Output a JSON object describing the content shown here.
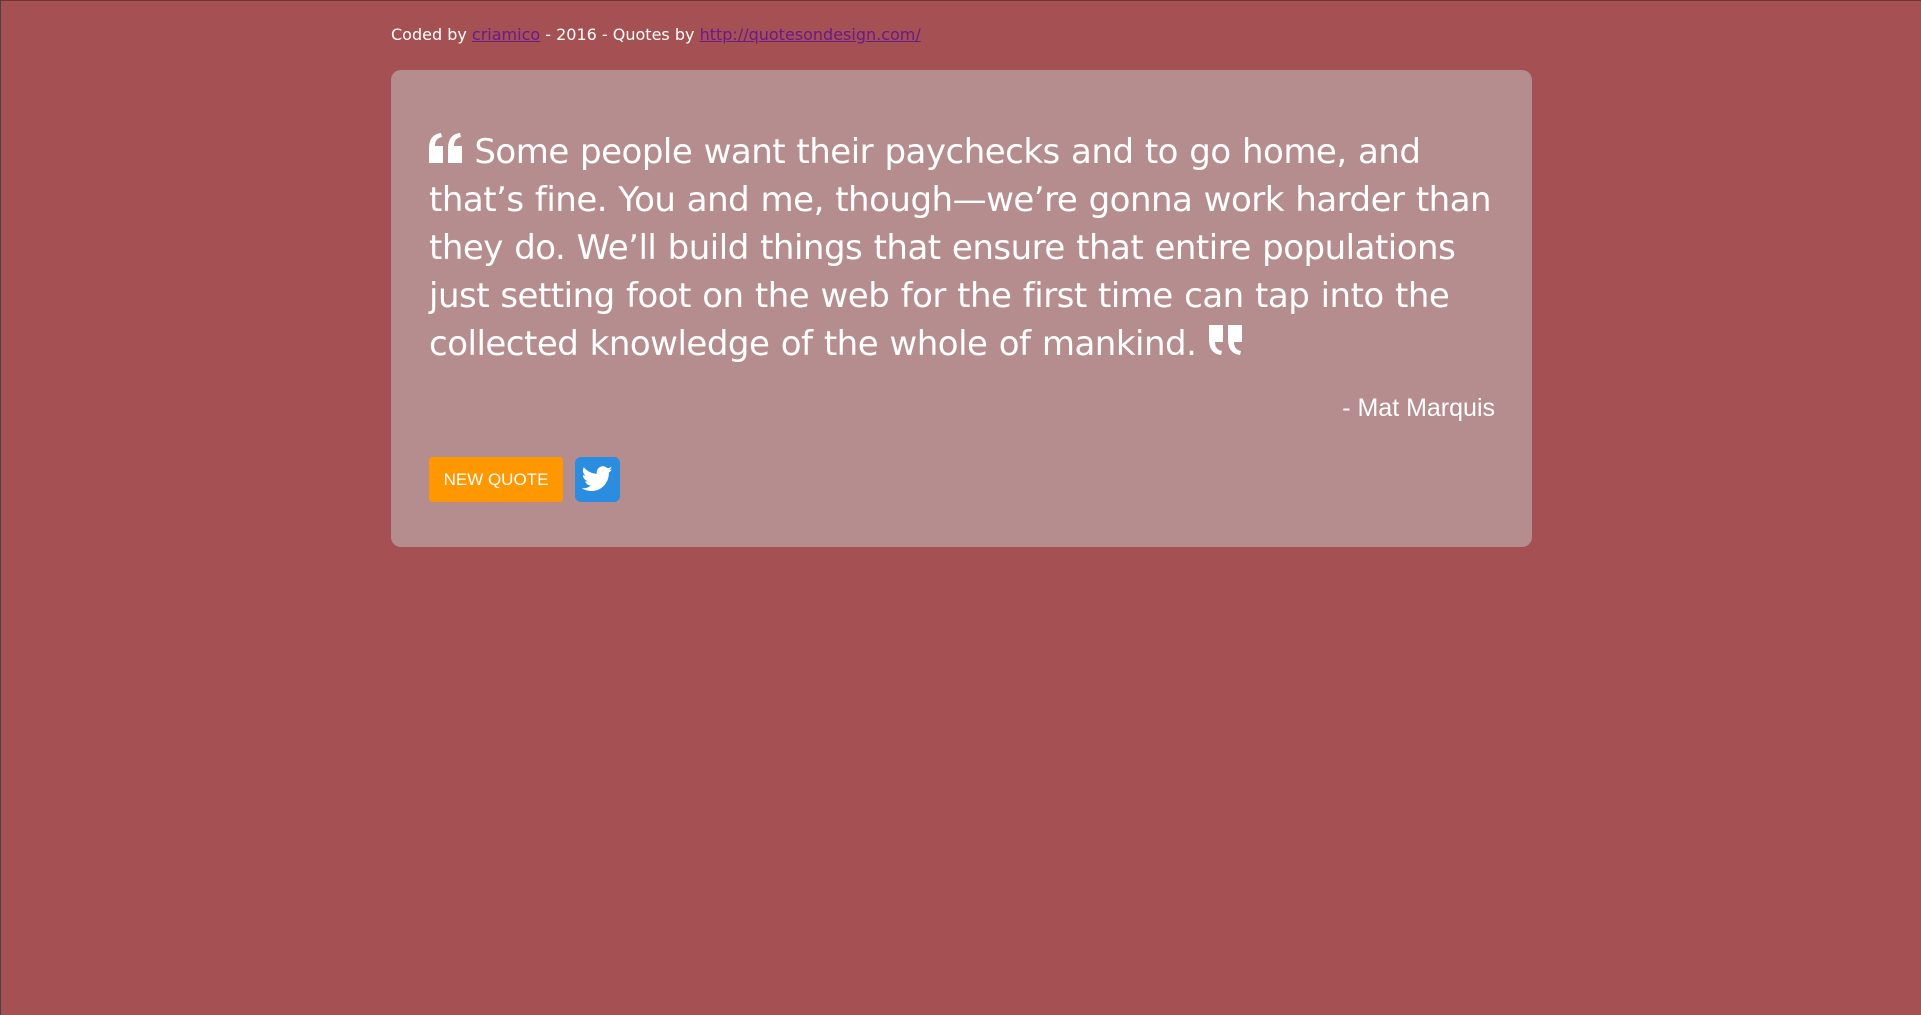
{
  "credits": {
    "prefix": "Coded by ",
    "author_link": "criamico",
    "middle": " - 2016 - Quotes by ",
    "source_link": "http://quotesondesign.com/"
  },
  "quote": {
    "text": "Some people want their paychecks and to go home, and that’s fine. You and me, though—we’re gonna work harder than they do. We’ll build things that ensure that entire populations just setting foot on the web for the first time can tap into the collected knowledge of the whole of mankind.",
    "author": "- Mat Marquis"
  },
  "buttons": {
    "new_quote": "NEW QUOTE",
    "tweet_icon": "twitter-icon"
  },
  "colors": {
    "background": "#a55052",
    "card": "#b58d8e",
    "new_quote_button": "#ff9800",
    "tweet_button": "#2a8de0",
    "link": "#6a1a8a"
  },
  "icons": {
    "open_quote": "quote-left-icon",
    "close_quote": "quote-right-icon"
  }
}
